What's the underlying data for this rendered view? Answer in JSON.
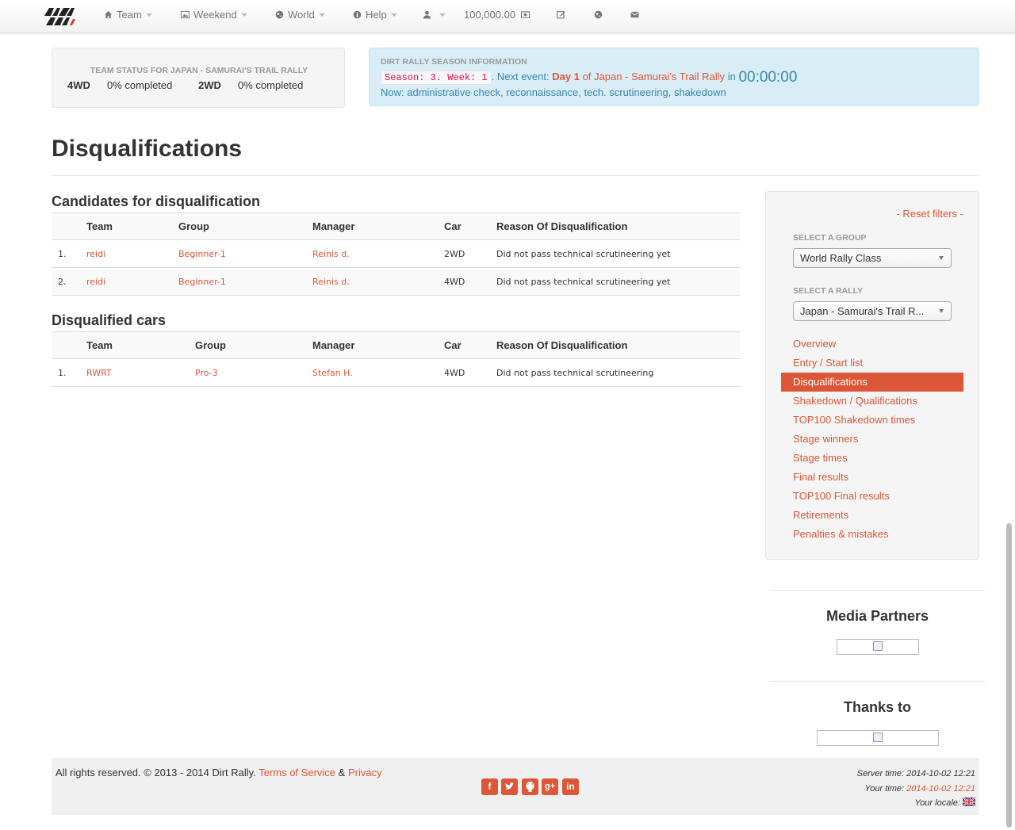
{
  "nav": {
    "team": "Team",
    "weekend": "Weekend",
    "world": "World",
    "help": "Help",
    "money": "100,000.00"
  },
  "team_status": {
    "title": "TEAM STATUS FOR JAPAN - SAMURAI'S TRAIL RALLY",
    "class1": "4WD",
    "class1_progress": "0% completed",
    "class2": "2WD",
    "class2_progress": "0% completed"
  },
  "season": {
    "title": "DIRT RALLY SEASON INFORMATION",
    "code": "Season: 3. Week: 1",
    "next_event": ". Next event:",
    "day": "Day 1",
    "of_text": "of Japan - Samurai's Trail Rally",
    "in_text": "in",
    "timer": "00:00:00",
    "now": "Now: administrative check, reconnaissance, tech. scrutineering, shakedown"
  },
  "page_title": "Disqualifications",
  "candidates": {
    "heading": "Candidates for disqualification",
    "columns": [
      "Team",
      "Group",
      "Manager",
      "Car",
      "Reason Of Disqualification"
    ],
    "rows": [
      {
        "num": "1.",
        "team": "reidi",
        "group": "Beginner-1",
        "manager": "Reinis d.",
        "car": "2WD",
        "reason": "Did not pass technical scrutineering yet"
      },
      {
        "num": "2.",
        "team": "reidi",
        "group": "Beginner-1",
        "manager": "Reinis d.",
        "car": "4WD",
        "reason": "Did not pass technical scrutineering yet"
      }
    ]
  },
  "disqualified": {
    "heading": "Disqualified cars",
    "columns": [
      "Team",
      "Group",
      "Manager",
      "Car",
      "Reason Of Disqualification"
    ],
    "rows": [
      {
        "num": "1.",
        "team": "RWRT",
        "group": "Pro-3",
        "manager": "Stefan H.",
        "car": "4WD",
        "reason": "Did not pass technical scrutineering"
      }
    ]
  },
  "sidebar": {
    "reset": "- Reset filters -",
    "group_label": "SELECT A GROUP",
    "group_value": "World Rally Class",
    "rally_label": "SELECT A RALLY",
    "rally_value": "Japan - Samurai's Trail R...",
    "links": [
      "Overview",
      "Entry / Start list",
      "Disqualifications",
      "Shakedown / Qualifications",
      "TOP100 Shakedown times",
      "Stage winners",
      "Stage times",
      "Final results",
      "TOP100 Final results",
      "Retirements",
      "Penalties & mistakes"
    ],
    "active_index": 2
  },
  "partners": {
    "media": "Media Partners",
    "thanks": "Thanks to"
  },
  "footer": {
    "rights": "All rights reserved. © 2013 - 2014 Dirt Rally.",
    "terms": "Terms of Service",
    "amp": "&",
    "privacy": "Privacy",
    "server_time_label": "Server time:",
    "server_time": "2014-10-02 12:21",
    "your_time_label": "Your time:",
    "your_time": "2014-10-02 12:21",
    "locale_label": "Your locale:"
  },
  "colors": {
    "accent": "#dd5638",
    "info_bg": "#d9edf7",
    "info_text": "#3a87ad"
  }
}
